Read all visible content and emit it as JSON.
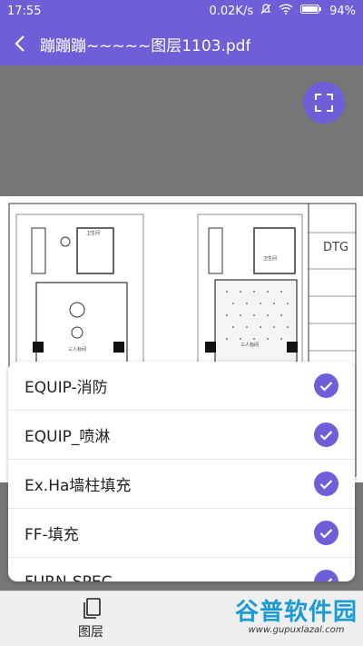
{
  "status": {
    "time": "17:55",
    "speed": "0.02K/s",
    "battery": "94%"
  },
  "appbar": {
    "title": "蹦蹦蹦~~~~~图层1103.pdf"
  },
  "drawing": {
    "logo": "DTG",
    "room_labels": [
      "卫生间",
      "三人标间",
      "卫生间",
      "三人标间"
    ]
  },
  "layers": [
    {
      "label": "EQUIP-消防",
      "checked": true
    },
    {
      "label": "EQUIP_喷淋",
      "checked": true
    },
    {
      "label": "Ex.Ha墙柱填充",
      "checked": true
    },
    {
      "label": "FF-填充",
      "checked": true
    },
    {
      "label": "FURN-SPEC",
      "checked": true
    }
  ],
  "bottom": {
    "layers_label": "图层"
  },
  "watermark": {
    "line1": "谷普软件园",
    "line2": "www.gupuxlazal.com"
  }
}
